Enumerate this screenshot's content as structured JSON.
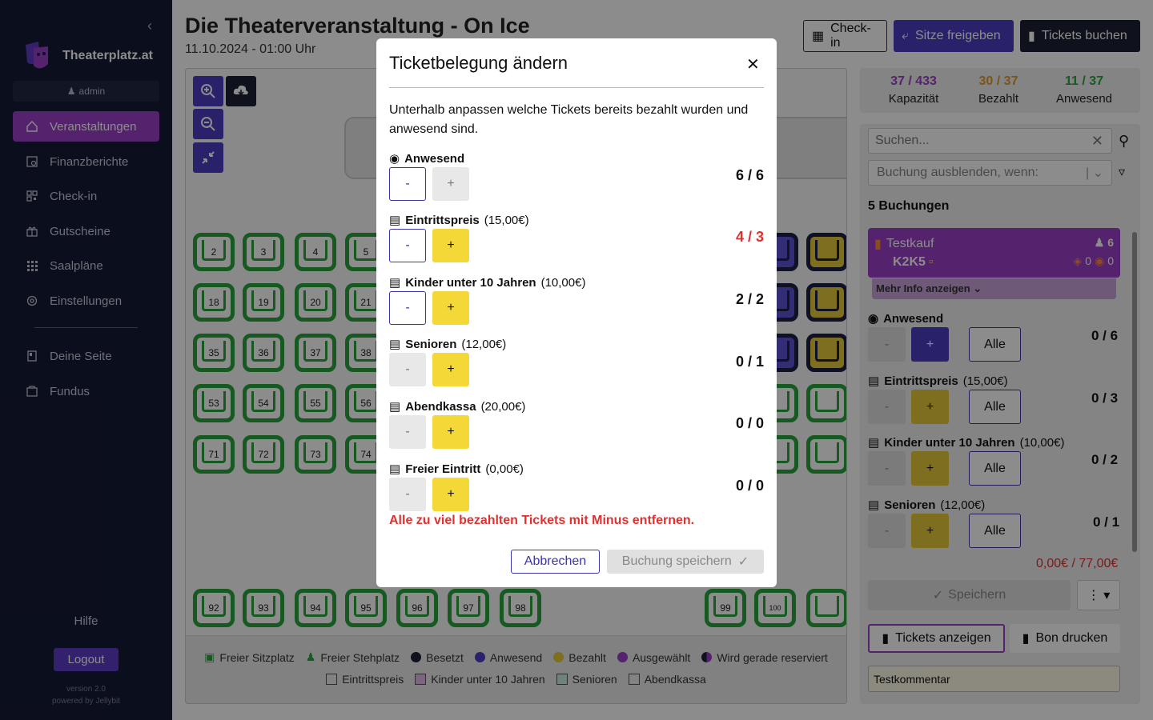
{
  "sidebar": {
    "brand": "Theaterplatz.at",
    "user": "admin",
    "items": [
      {
        "label": "Veranstaltungen",
        "icon": "home-icon"
      },
      {
        "label": "Finanzberichte",
        "icon": "report-icon"
      },
      {
        "label": "Check-in",
        "icon": "qr-icon"
      },
      {
        "label": "Gutscheine",
        "icon": "gift-icon"
      },
      {
        "label": "Saalpläne",
        "icon": "grid-icon"
      },
      {
        "label": "Einstellungen",
        "icon": "gear-icon"
      }
    ],
    "items2": [
      {
        "label": "Deine Seite",
        "icon": "page-icon"
      },
      {
        "label": "Fundus",
        "icon": "box-icon"
      }
    ],
    "help": "Hilfe",
    "logout": "Logout",
    "version": "version 2.0",
    "powered": "powered by Jellybit"
  },
  "header": {
    "title": "Die Theaterveranstaltung - On Ice",
    "date": "11.10.2024 - 01:00 Uhr",
    "checkin": "Check-in",
    "release": "Sitze freigeben",
    "book": "Tickets buchen"
  },
  "seats": {
    "row1": [
      "2",
      "3",
      "4",
      "5"
    ],
    "row2": [
      "18",
      "19",
      "20",
      "21"
    ],
    "row3": [
      "35",
      "36",
      "37",
      "38"
    ],
    "row4": [
      "53",
      "54",
      "55",
      "56"
    ],
    "row5": [
      "71",
      "72",
      "73",
      "74"
    ],
    "row6": [
      "92",
      "93",
      "94",
      "95",
      "96",
      "97",
      "98"
    ],
    "row6b": [
      "99",
      "100"
    ]
  },
  "legend": {
    "row1": [
      "Freier Sitzplatz",
      "Freier Stehplatz",
      "Besetzt",
      "Anwesend",
      "Bezahlt",
      "Ausgewählt",
      "Wird gerade reserviert"
    ],
    "row2": [
      "Eintrittspreis",
      "Kinder unter 10 Jahren",
      "Senioren",
      "Abendkassa"
    ]
  },
  "stats": {
    "capacity_value": "37 / 433",
    "capacity_label": "Kapazität",
    "paid_value": "30 / 37",
    "paid_label": "Bezahlt",
    "present_value": "11 / 37",
    "present_label": "Anwesend"
  },
  "panel": {
    "search_placeholder": "Suchen...",
    "filter_placeholder": "Buchung ausblenden, wenn:",
    "bookings_count": "5 Buchungen",
    "booking": {
      "name": "Testkauf",
      "code": "K2K5",
      "people": "6",
      "tags": "0",
      "present": "0",
      "more": "Mehr Info anzeigen"
    },
    "rows": [
      {
        "label": "Anwesend",
        "price": "",
        "count": "0 / 6",
        "alle": "Alle"
      },
      {
        "label": "Eintrittspreis",
        "price": "(15,00€)",
        "count": "0 / 3",
        "alle": "Alle"
      },
      {
        "label": "Kinder unter 10 Jahren",
        "price": "(10,00€)",
        "count": "0 / 2",
        "alle": "Alle"
      },
      {
        "label": "Senioren",
        "price": "(12,00€)",
        "count": "0 / 1",
        "alle": "Alle"
      }
    ],
    "total": "0,00€ / 77,00€",
    "save": "Speichern",
    "show_tickets": "Tickets anzeigen",
    "print": "Bon drucken",
    "comment": "Testkommentar"
  },
  "modal": {
    "title": "Ticketbelegung ändern",
    "desc": "Unterhalb anpassen welche Tickets bereits bezahlt wurden und anwesend sind.",
    "rows": [
      {
        "label": "Anwesend",
        "price": "",
        "count": "6 / 6"
      },
      {
        "label": "Eintrittspreis",
        "price": "(15,00€)",
        "count": "4 / 3"
      },
      {
        "label": "Kinder unter 10 Jahren",
        "price": "(10,00€)",
        "count": "2 / 2"
      },
      {
        "label": "Senioren",
        "price": "(12,00€)",
        "count": "0 / 1"
      },
      {
        "label": "Abendkassa",
        "price": "(20,00€)",
        "count": "0 / 0"
      },
      {
        "label": "Freier Eintritt",
        "price": "(0,00€)",
        "count": "0 / 0"
      }
    ],
    "minus": "-",
    "plus": "+",
    "error": "Alle zu viel bezahlten Tickets mit Minus entfernen.",
    "cancel": "Abbrechen",
    "save": "Buchung speichern"
  },
  "colors": {
    "sidebar_bg": "#151a36",
    "accent_purple": "#9c3fc7",
    "primary": "#4b3ec2",
    "paid_yellow": "#f4d838",
    "free_green": "#2aa43c",
    "error_red": "#e03030"
  }
}
